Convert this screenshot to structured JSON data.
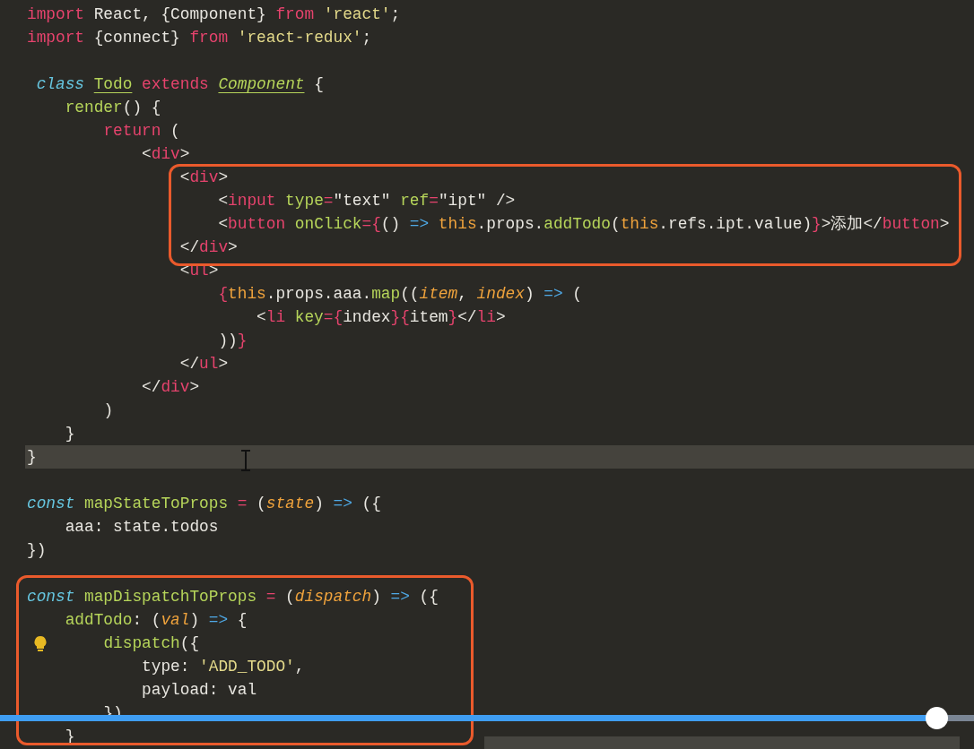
{
  "editor": {
    "lines": [
      {
        "current": false,
        "tokens": [
          {
            "text": "import",
            "kind": "keyword"
          },
          {
            "text": " React, {Component} ",
            "kind": "plain"
          },
          {
            "text": "from",
            "kind": "keyword"
          },
          {
            "text": " 'react'",
            "kind": "string"
          },
          {
            "text": ";",
            "kind": "plain"
          }
        ]
      },
      {
        "current": false,
        "tokens": [
          {
            "text": "import",
            "kind": "keyword"
          },
          {
            "text": " {connect} ",
            "kind": "plain"
          },
          {
            "text": "from",
            "kind": "keyword"
          },
          {
            "text": " 'react-redux'",
            "kind": "string"
          },
          {
            "text": ";",
            "kind": "plain"
          }
        ]
      },
      {
        "current": false
      },
      {
        "current": false,
        "tokens": [
          {
            "text": " class ",
            "kind": "storage"
          },
          {
            "text": "Todo",
            "kind": "class"
          },
          {
            "text": " extends ",
            "kind": "keyword"
          },
          {
            "text": "Component",
            "kind": "superclass"
          },
          {
            "text": " {",
            "kind": "plain"
          }
        ]
      },
      {
        "current": false,
        "tokens": [
          {
            "text": "    render",
            "kind": "func"
          },
          {
            "text": "() {",
            "kind": "plain"
          }
        ]
      },
      {
        "current": false,
        "tokens": [
          {
            "text": "        return",
            "kind": "keyword"
          },
          {
            "text": " (",
            "kind": "plain"
          }
        ]
      },
      {
        "current": false,
        "tokens": [
          {
            "text": "            <",
            "kind": "plain"
          },
          {
            "text": "div",
            "kind": "tag"
          },
          {
            "text": ">",
            "kind": "plain"
          }
        ]
      },
      {
        "current": false,
        "tokens": [
          {
            "text": "                <",
            "kind": "plain"
          },
          {
            "text": "div",
            "kind": "tag"
          },
          {
            "text": ">",
            "kind": "plain"
          }
        ]
      },
      {
        "current": false,
        "tokens": [
          {
            "text": "                    <",
            "kind": "plain"
          },
          {
            "text": "input",
            "kind": "tag"
          },
          {
            "text": " type",
            "kind": "attr"
          },
          {
            "text": "=",
            "kind": "punct"
          },
          {
            "text": "\"text\"",
            "kind": "plain"
          },
          {
            "text": " ref",
            "kind": "attr"
          },
          {
            "text": "=",
            "kind": "punct"
          },
          {
            "text": "\"ipt\"",
            "kind": "plain"
          },
          {
            "text": " />",
            "kind": "plain"
          }
        ]
      },
      {
        "current": false,
        "tokens": [
          {
            "text": "                    <",
            "kind": "plain"
          },
          {
            "text": "button",
            "kind": "tag"
          },
          {
            "text": " onClick",
            "kind": "attr"
          },
          {
            "text": "={",
            "kind": "punct"
          },
          {
            "text": "() ",
            "kind": "plain"
          },
          {
            "text": "=>",
            "kind": "op"
          },
          {
            "text": " this",
            "kind": "this"
          },
          {
            "text": ".props.",
            "kind": "plain"
          },
          {
            "text": "addTodo",
            "kind": "func"
          },
          {
            "text": "(",
            "kind": "plain"
          },
          {
            "text": "this",
            "kind": "this"
          },
          {
            "text": ".refs.ipt.value)",
            "kind": "plain"
          },
          {
            "text": "}",
            "kind": "punct"
          },
          {
            "text": ">添加</",
            "kind": "plain"
          },
          {
            "text": "button",
            "kind": "tag"
          },
          {
            "text": ">",
            "kind": "plain"
          }
        ]
      },
      {
        "current": false,
        "tokens": [
          {
            "text": "                </",
            "kind": "plain"
          },
          {
            "text": "div",
            "kind": "tag"
          },
          {
            "text": ">",
            "kind": "plain"
          }
        ]
      },
      {
        "current": false,
        "tokens": [
          {
            "text": "                <",
            "kind": "plain"
          },
          {
            "text": "ul",
            "kind": "tag"
          },
          {
            "text": ">",
            "kind": "plain"
          }
        ]
      },
      {
        "current": false,
        "tokens": [
          {
            "text": "                    {",
            "kind": "punct"
          },
          {
            "text": "this",
            "kind": "this"
          },
          {
            "text": ".props.aaa.",
            "kind": "plain"
          },
          {
            "text": "map",
            "kind": "func"
          },
          {
            "text": "((",
            "kind": "plain"
          },
          {
            "text": "item",
            "kind": "param"
          },
          {
            "text": ", ",
            "kind": "plain"
          },
          {
            "text": "index",
            "kind": "param"
          },
          {
            "text": ") ",
            "kind": "plain"
          },
          {
            "text": "=>",
            "kind": "op"
          },
          {
            "text": " (",
            "kind": "plain"
          }
        ]
      },
      {
        "current": false,
        "tokens": [
          {
            "text": "                        <",
            "kind": "plain"
          },
          {
            "text": "li",
            "kind": "tag"
          },
          {
            "text": " key",
            "kind": "attr"
          },
          {
            "text": "={",
            "kind": "punct"
          },
          {
            "text": "index",
            "kind": "plain"
          },
          {
            "text": "}{",
            "kind": "punct"
          },
          {
            "text": "item",
            "kind": "plain"
          },
          {
            "text": "}",
            "kind": "punct"
          },
          {
            "text": "</",
            "kind": "plain"
          },
          {
            "text": "li",
            "kind": "tag"
          },
          {
            "text": ">",
            "kind": "plain"
          }
        ]
      },
      {
        "current": false,
        "tokens": [
          {
            "text": "                    ))",
            "kind": "plain"
          },
          {
            "text": "}",
            "kind": "punct"
          }
        ]
      },
      {
        "current": false,
        "tokens": [
          {
            "text": "                </",
            "kind": "plain"
          },
          {
            "text": "ul",
            "kind": "tag"
          },
          {
            "text": ">",
            "kind": "plain"
          }
        ]
      },
      {
        "current": false,
        "tokens": [
          {
            "text": "            </",
            "kind": "plain"
          },
          {
            "text": "div",
            "kind": "tag"
          },
          {
            "text": ">",
            "kind": "plain"
          }
        ]
      },
      {
        "current": false,
        "tokens": [
          {
            "text": "        )",
            "kind": "plain"
          }
        ]
      },
      {
        "current": false,
        "tokens": [
          {
            "text": "    }",
            "kind": "plain"
          }
        ]
      },
      {
        "current": true,
        "tokens": [
          {
            "text": "}",
            "kind": "plain"
          }
        ]
      },
      {
        "current": false
      },
      {
        "current": false,
        "tokens": [
          {
            "text": "const ",
            "kind": "storage"
          },
          {
            "text": "mapStateToProps",
            "kind": "func"
          },
          {
            "text": " =",
            "kind": "punct"
          },
          {
            "text": " (",
            "kind": "plain"
          },
          {
            "text": "state",
            "kind": "param"
          },
          {
            "text": ") ",
            "kind": "plain"
          },
          {
            "text": "=>",
            "kind": "op"
          },
          {
            "text": " ({",
            "kind": "plain"
          }
        ]
      },
      {
        "current": false,
        "tokens": [
          {
            "text": "    aaa: state.todos",
            "kind": "plain"
          }
        ]
      },
      {
        "current": false,
        "tokens": [
          {
            "text": "})",
            "kind": "plain"
          }
        ]
      },
      {
        "current": false
      },
      {
        "current": false,
        "tokens": [
          {
            "text": "const ",
            "kind": "storage"
          },
          {
            "text": "mapDispatchToProps",
            "kind": "func"
          },
          {
            "text": " =",
            "kind": "punct"
          },
          {
            "text": " (",
            "kind": "plain"
          },
          {
            "text": "dispatch",
            "kind": "param"
          },
          {
            "text": ") ",
            "kind": "plain"
          },
          {
            "text": "=>",
            "kind": "op"
          },
          {
            "text": " ({",
            "kind": "plain"
          }
        ]
      },
      {
        "current": false,
        "tokens": [
          {
            "text": "    addTodo",
            "kind": "func"
          },
          {
            "text": ": (",
            "kind": "plain"
          },
          {
            "text": "val",
            "kind": "param"
          },
          {
            "text": ") ",
            "kind": "plain"
          },
          {
            "text": "=>",
            "kind": "op"
          },
          {
            "text": " {",
            "kind": "plain"
          }
        ]
      },
      {
        "current": false,
        "hint": true,
        "tokens": [
          {
            "text": "        dispatch",
            "kind": "func"
          },
          {
            "text": "({",
            "kind": "plain"
          }
        ]
      },
      {
        "current": false,
        "tokens": [
          {
            "text": "            type: ",
            "kind": "plain"
          },
          {
            "text": "'ADD_TODO'",
            "kind": "string"
          },
          {
            "text": ",",
            "kind": "plain"
          }
        ]
      },
      {
        "current": false,
        "tokens": [
          {
            "text": "            payload: val",
            "kind": "plain"
          }
        ]
      },
      {
        "current": false,
        "tokens": [
          {
            "text": "        })",
            "kind": "plain"
          }
        ]
      },
      {
        "current": false,
        "tokens": [
          {
            "text": "    }",
            "kind": "plain"
          }
        ]
      }
    ]
  },
  "player": {
    "progress": {
      "level": 0.961
    }
  }
}
